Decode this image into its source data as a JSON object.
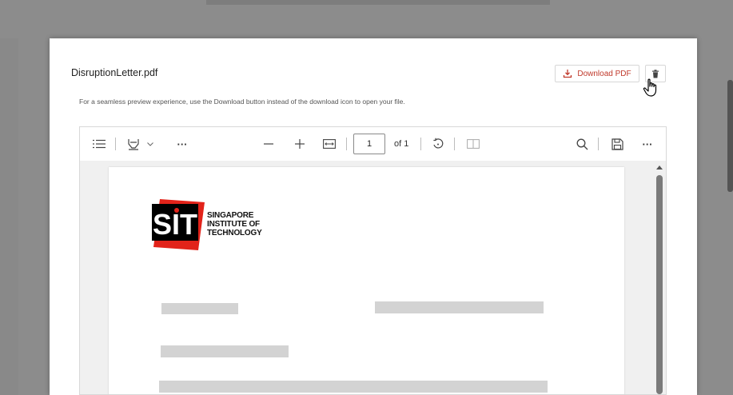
{
  "modal": {
    "file_name": "DisruptionLetter.pdf",
    "subtitle": "For a seamless preview experience, use the Download button instead of the download icon to open your file.",
    "download_label": "Download PDF"
  },
  "viewer": {
    "page_number": "1",
    "page_total": "of 1",
    "more_label": "···"
  },
  "document": {
    "logo_lines": [
      "SINGAPORE",
      "INSTITUTE OF",
      "TECHNOLOGY"
    ],
    "logo_mark": "SIT"
  },
  "colors": {
    "accent": "#c0392b",
    "overlay": "rgba(0,0,0,0.45)"
  }
}
